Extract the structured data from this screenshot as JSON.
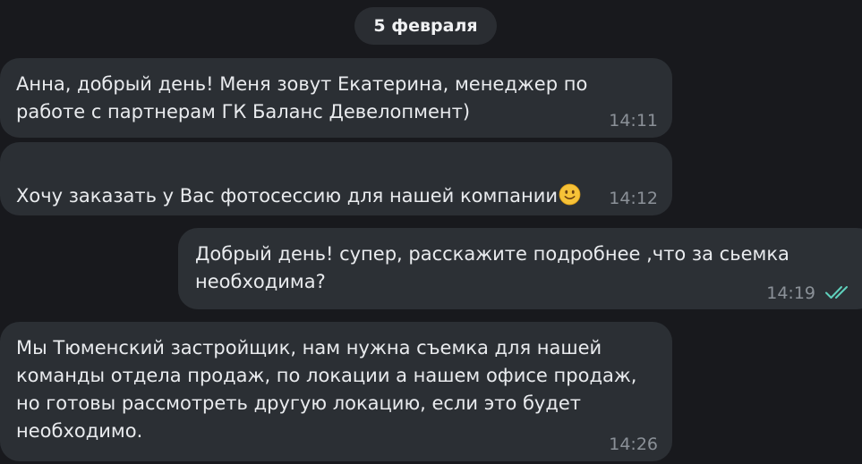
{
  "chat": {
    "date_separator": "5 февраля",
    "messages": [
      {
        "direction": "incoming",
        "text": "Анна, добрый день! Меня зовут Екатерина, менеджер по\nработе с партнерам ГК Баланс Девелопмент)",
        "time": "14:11"
      },
      {
        "direction": "incoming",
        "text": "Хочу заказать у Вас фотосессию для нашей компании",
        "emoji": "slightly-smiling-face-icon",
        "time": "14:12"
      },
      {
        "direction": "outgoing",
        "text": "Добрый день! супер, расскажите подробнее ,что за сьемка\nнеобходима?",
        "time": "14:19",
        "status": "read",
        "status_icon": "double-check-icon"
      },
      {
        "direction": "incoming",
        "text": "Мы Тюменский застройщик, нам нужна съемка для нашей\nкоманды отдела продаж, по локации а нашем офисе продаж,\nно готовы рассмотреть другую локацию, если это будет\nнеобходимо.",
        "time": "14:26"
      }
    ]
  },
  "colors": {
    "background": "#18191d",
    "incoming_bubble": "#2b2f34",
    "outgoing_bubble": "#2c3035",
    "message_text": "#e9ebee",
    "time_text": "#8b9198",
    "read_check": "#5fd0bc",
    "date_pill": "#2a2d32"
  }
}
